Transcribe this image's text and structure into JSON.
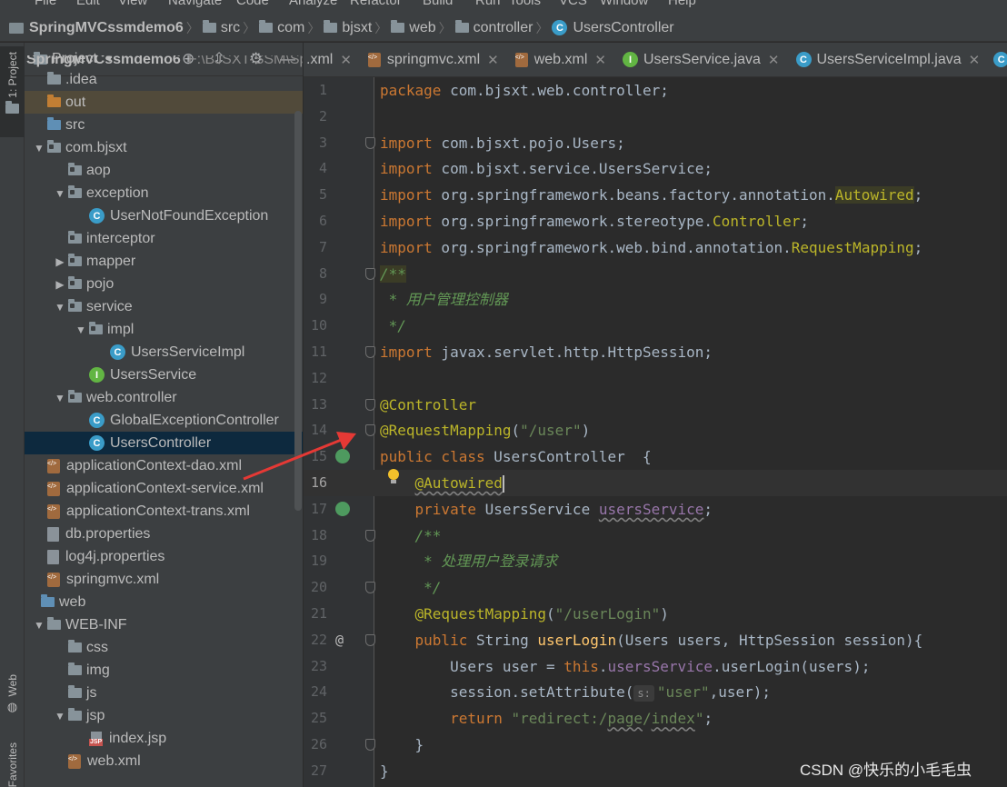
{
  "menu": [
    "File",
    "Edit",
    "View",
    "Navigate",
    "Code",
    "Analyze",
    "Refactor",
    "Build",
    "Run",
    "Tools",
    "VCS",
    "Window",
    "Help"
  ],
  "breadcrumbs": [
    {
      "label": "SpringMVCssmdemo6",
      "icon": "project-icon",
      "bold": true
    },
    {
      "label": "src",
      "icon": "folder-icon"
    },
    {
      "label": "com",
      "icon": "folder-icon"
    },
    {
      "label": "bjsxt",
      "icon": "folder-icon"
    },
    {
      "label": "web",
      "icon": "folder-icon"
    },
    {
      "label": "controller",
      "icon": "folder-icon"
    },
    {
      "label": "UsersController",
      "icon": "class-icon"
    }
  ],
  "sidebar": {
    "project_tab": "1: Project",
    "web_tab": "Web",
    "favorites_tab": "2: Favorites"
  },
  "project_panel": {
    "title": "Project",
    "root_label": "SpringMVCssmdemo6",
    "root_path": "F:\\BJSXT-SSM\\Spr",
    "tree": [
      {
        "label": ".idea",
        "icon": "folder",
        "indent": 0,
        "arrow": ""
      },
      {
        "label": "out",
        "icon": "folder-orange",
        "indent": 0,
        "arrow": "",
        "highlight": true
      },
      {
        "label": "src",
        "icon": "folder-blue",
        "indent": 0,
        "arrow": ""
      },
      {
        "label": "com.bjsxt",
        "icon": "package",
        "indent": 0,
        "arrow": "▼"
      },
      {
        "label": "aop",
        "icon": "package",
        "indent": 1,
        "arrow": ""
      },
      {
        "label": "exception",
        "icon": "package",
        "indent": 1,
        "arrow": "▼"
      },
      {
        "label": "UserNotFoundException",
        "icon": "class",
        "indent": 2,
        "arrow": ""
      },
      {
        "label": "interceptor",
        "icon": "package",
        "indent": 1,
        "arrow": ""
      },
      {
        "label": "mapper",
        "icon": "package",
        "indent": 1,
        "arrow": "▶"
      },
      {
        "label": "pojo",
        "icon": "package",
        "indent": 1,
        "arrow": "▶"
      },
      {
        "label": "service",
        "icon": "package",
        "indent": 1,
        "arrow": "▼"
      },
      {
        "label": "impl",
        "icon": "package",
        "indent": 2,
        "arrow": "▼"
      },
      {
        "label": "UsersServiceImpl",
        "icon": "class",
        "indent": 3,
        "arrow": ""
      },
      {
        "label": "UsersService",
        "icon": "interface",
        "indent": 2,
        "arrow": ""
      },
      {
        "label": "web.controller",
        "icon": "package",
        "indent": 1,
        "arrow": "▼"
      },
      {
        "label": "GlobalExceptionController",
        "icon": "class",
        "indent": 2,
        "arrow": ""
      },
      {
        "label": "UsersController",
        "icon": "class",
        "indent": 2,
        "arrow": "",
        "selected": true
      },
      {
        "label": "applicationContext-dao.xml",
        "icon": "xml",
        "indent": 0,
        "arrow": ""
      },
      {
        "label": "applicationContext-service.xml",
        "icon": "xml",
        "indent": 0,
        "arrow": ""
      },
      {
        "label": "applicationContext-trans.xml",
        "icon": "xml",
        "indent": 0,
        "arrow": ""
      },
      {
        "label": "db.properties",
        "icon": "file",
        "indent": 0,
        "arrow": ""
      },
      {
        "label": "log4j.properties",
        "icon": "file",
        "indent": 0,
        "arrow": ""
      },
      {
        "label": "springmvc.xml",
        "icon": "xml",
        "indent": 0,
        "arrow": ""
      },
      {
        "label": "web",
        "icon": "folder-blue",
        "indent": -1,
        "arrow": ""
      },
      {
        "label": "WEB-INF",
        "icon": "folder",
        "indent": 0,
        "arrow": "▼"
      },
      {
        "label": "css",
        "icon": "folder",
        "indent": 1,
        "arrow": ""
      },
      {
        "label": "img",
        "icon": "folder",
        "indent": 1,
        "arrow": ""
      },
      {
        "label": "js",
        "icon": "folder",
        "indent": 1,
        "arrow": ""
      },
      {
        "label": "jsp",
        "icon": "folder",
        "indent": 1,
        "arrow": "▼"
      },
      {
        "label": "index.jsp",
        "icon": "jsp",
        "indent": 2,
        "arrow": ""
      },
      {
        "label": "web.xml",
        "icon": "xml",
        "indent": 1,
        "arrow": ""
      }
    ]
  },
  "tabs": [
    {
      "label": ".xml",
      "icon": "",
      "partial": true
    },
    {
      "label": "springmvc.xml",
      "icon": "xml"
    },
    {
      "label": "web.xml",
      "icon": "xml"
    },
    {
      "label": "UsersService.java",
      "icon": "interface"
    },
    {
      "label": "UsersServiceImpl.java",
      "icon": "class"
    }
  ],
  "editor": {
    "current_line": 16,
    "lines": [
      {
        "n": 1,
        "html": "<span class=\"kw\">package</span> com.bjsxt.web.controller;"
      },
      {
        "n": 2,
        "html": ""
      },
      {
        "n": 3,
        "html": "<span class=\"kw\">import</span> com.bjsxt.pojo.Users;",
        "fold": true
      },
      {
        "n": 4,
        "html": "<span class=\"kw\">import</span> com.bjsxt.service.UsersService;"
      },
      {
        "n": 5,
        "html": "<span class=\"kw\">import</span> org.springframework.beans.factory.annotation.<span class=\"ann hl-warn\">Autowired</span>;"
      },
      {
        "n": 6,
        "html": "<span class=\"kw\">import</span> org.springframework.stereotype.<span class=\"ann\">Controller</span>;"
      },
      {
        "n": 7,
        "html": "<span class=\"kw\">import</span> org.springframework.web.bind.annotation.<span class=\"ann\">RequestMapping</span>;"
      },
      {
        "n": 8,
        "html": "<span class=\"cmt hl-warn\">/**</span>",
        "fold": true
      },
      {
        "n": 9,
        "html": "<span class=\"cmt\"> * 用户管理控制器</span>"
      },
      {
        "n": 10,
        "html": "<span class=\"cmt\"> */</span>"
      },
      {
        "n": 11,
        "html": "<span class=\"kw\">import</span> javax.servlet.http.HttpSession;",
        "fold": true
      },
      {
        "n": 12,
        "html": ""
      },
      {
        "n": 13,
        "html": "<span class=\"ann\">@Controller</span>",
        "fold": true
      },
      {
        "n": 14,
        "html": "<span class=\"ann\">@RequestMapping</span>(<span class=\"str\">\"/user\"</span>)",
        "fold": true
      },
      {
        "n": 15,
        "html": "<span class=\"kw\">public class</span> UsersController  {",
        "gutter": "bean"
      },
      {
        "n": 16,
        "html": "    <span class=\"ann wv\">@Autowired</span><span class=\"cursor\"></span>"
      },
      {
        "n": 17,
        "html": "    <span class=\"kw\">private</span> UsersService <span class=\"fld wv\">usersService</span>;",
        "gutter": "inject"
      },
      {
        "n": 18,
        "html": "    <span class=\"cmt\">/**</span>",
        "fold": true
      },
      {
        "n": 19,
        "html": "<span class=\"cmt\">     * 处理用户登录请求</span>"
      },
      {
        "n": 20,
        "html": "<span class=\"cmt\">     */</span>",
        "fold": true
      },
      {
        "n": 21,
        "html": "    <span class=\"ann\">@RequestMapping</span>(<span class=\"str\">\"/userLogin\"</span>)"
      },
      {
        "n": 22,
        "html": "    <span class=\"kw\">public</span> String <span class=\"mth\">userLogin</span>(Users users, HttpSession session){",
        "gutter": "at",
        "fold": true
      },
      {
        "n": 23,
        "html": "        Users user = <span class=\"kw\">this</span>.<span class=\"fld\">usersService</span>.userLogin(users);"
      },
      {
        "n": 24,
        "html": "        session.setAttribute(<span class=\"hint-box\">s:</span><span class=\"str\">\"user\"</span>,user);"
      },
      {
        "n": 25,
        "html": "        <span class=\"kw\">return</span> <span class=\"str\">\"redirect:/<span class=\"wv\">page</span>/<span class=\"wv\">index</span>\"</span>;"
      },
      {
        "n": 26,
        "html": "    }",
        "fold": true
      },
      {
        "n": 27,
        "html": "}"
      }
    ]
  },
  "watermark": "CSDN @快乐的小毛毛虫",
  "colors": {
    "background": "#2b2b2b",
    "panel": "#3c3f41",
    "selection": "#0d293e",
    "annotation": "#bbb529",
    "keyword": "#cc7832",
    "arrow": "#e53935"
  }
}
